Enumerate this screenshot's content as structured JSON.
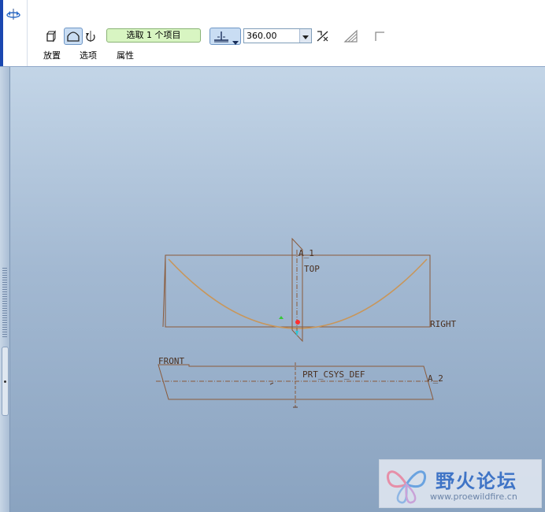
{
  "dashboard": {
    "selection_collector": "选取 1 个项目",
    "angle": {
      "value": "360.00"
    },
    "tabs": [
      {
        "label": "放置"
      },
      {
        "label": "选项"
      },
      {
        "label": "属性"
      }
    ]
  },
  "model": {
    "datum_labels": {
      "a1": "A_1",
      "top": "TOP",
      "right": "RIGHT",
      "front": "FRONT",
      "csys": "PRT_CSYS_DEF",
      "a2": "A_2"
    }
  },
  "watermark": {
    "name": "野火论坛",
    "url": "www.proewildfire.cn"
  },
  "colors": {
    "datum_plane": "#8a5a3a",
    "sketch_curve": "#c8965a",
    "selection": "#ff3030",
    "accent": "#6f97c6",
    "collector_bg": "#d8f5c2"
  }
}
